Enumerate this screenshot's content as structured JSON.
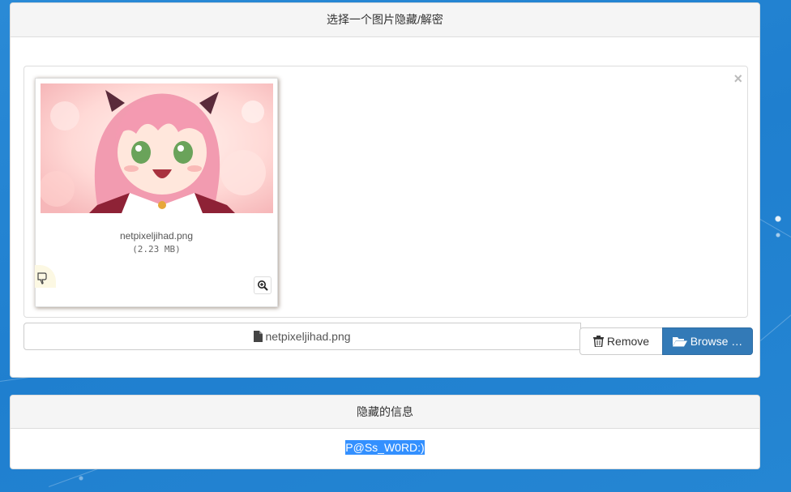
{
  "hide_panel": {
    "title": "选择一个图片隐藏/解密"
  },
  "preview": {
    "file_name": "netpixeljihad.png",
    "file_size": "(2.23 MB)",
    "close_glyph": "×",
    "image_subject": "anime girl with pink hair",
    "icons": {
      "drag": "hand-pointer-icon",
      "zoom": "zoom-in-icon"
    }
  },
  "caption": {
    "file_name": "netpixeljihad.png",
    "icon": "file-icon"
  },
  "buttons": {
    "remove_label": "Remove",
    "remove_icon": "trash-icon",
    "browse_label": "Browse …",
    "browse_icon": "folder-open-icon"
  },
  "message_panel": {
    "title": "隐藏的信息",
    "message": "P@Ss_W0RD:)"
  },
  "colors": {
    "background": "#2384d3",
    "primary_button": "#337ab7",
    "selection_highlight": "#3390ff"
  }
}
